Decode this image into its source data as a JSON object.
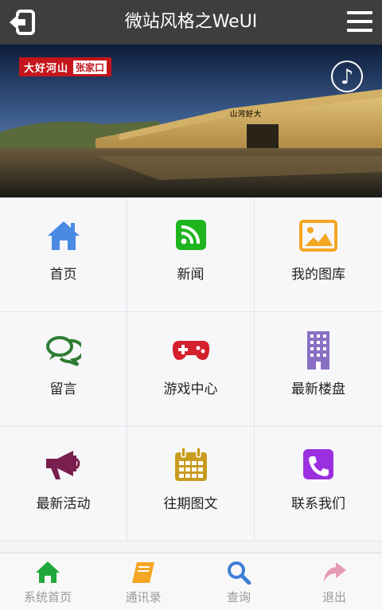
{
  "header": {
    "title": "微站风格之WeUI"
  },
  "banner": {
    "brand_text": "大好河山",
    "brand_sub": "张家口",
    "sign_text": "山河好大",
    "music_glyph": "♪"
  },
  "grid": {
    "items": [
      {
        "label": "首页",
        "icon": "home-icon",
        "color": "#4a8ae3"
      },
      {
        "label": "新闻",
        "icon": "rss-icon",
        "color": "#1fb51f"
      },
      {
        "label": "我的图库",
        "icon": "image-icon",
        "color": "#f5a623"
      },
      {
        "label": "留言",
        "icon": "chat-icon",
        "color": "#2e7d32"
      },
      {
        "label": "游戏中心",
        "icon": "gamepad-icon",
        "color": "#d4202d"
      },
      {
        "label": "最新楼盘",
        "icon": "building-icon",
        "color": "#8a6fc4"
      },
      {
        "label": "最新活动",
        "icon": "megaphone-icon",
        "color": "#7a1e4e"
      },
      {
        "label": "往期图文",
        "icon": "calendar-icon",
        "color": "#c89b1e"
      },
      {
        "label": "联系我们",
        "icon": "phone-icon",
        "color": "#9b2fe0"
      }
    ]
  },
  "tabbar": {
    "items": [
      {
        "label": "系统首页",
        "icon": "home-icon",
        "color": "#20a83a"
      },
      {
        "label": "通讯录",
        "icon": "book-icon",
        "color": "#f5a623"
      },
      {
        "label": "查询",
        "icon": "search-icon",
        "color": "#3f7fd6"
      },
      {
        "label": "退出",
        "icon": "share-icon",
        "color": "#e59ab3"
      }
    ]
  }
}
